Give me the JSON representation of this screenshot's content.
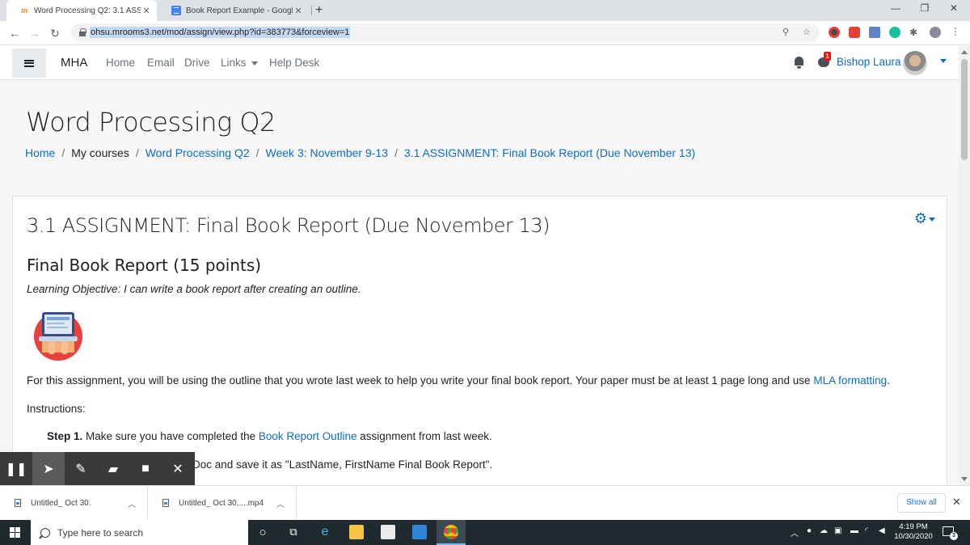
{
  "browser": {
    "tabs": [
      {
        "title": "Word Processing Q2: 3.1 ASSIGN",
        "active": true
      },
      {
        "title": "Book Report Example - Google D",
        "active": false
      }
    ],
    "url": "ohsu.mrooms3.net/mod/assign/view.php?id=383773&forceview=1"
  },
  "nav": {
    "brand": "MHA",
    "links": [
      "Home",
      "Email",
      "Drive",
      "Links",
      "Help Desk"
    ],
    "message_badge": "1",
    "user_name": "Bishop Laura"
  },
  "page": {
    "title": "Word Processing Q2",
    "breadcrumb": [
      "Home",
      "My courses",
      "Word Processing Q2",
      "Week 3: November 9-13",
      "3.1 ASSIGNMENT: Final Book Report (Due November 13)"
    ],
    "breadcrumb_sep": "/"
  },
  "assignment": {
    "title": "3.1 ASSIGNMENT: Final Book Report (Due November 13)",
    "heading": "Final Book Report (15 points)",
    "objective": "Learning Objective: I can write a book report after creating an outline.",
    "intro_text": "For this assignment, you will be using the outline that you wrote last week to help you write your final book report. Your paper must be at least 1 page long and use ",
    "intro_link": "MLA formatting",
    "intro_end": ".",
    "instructions_label": "Instructions:",
    "step1_label": "Step 1.",
    "step1_pre": " Make sure you have completed the ",
    "step1_link": "Book Report Outline",
    "step1_post": " assignment from last week.",
    "step2_partial": "Doc and save it as \"LastName, FirstName Final Book Report\"."
  },
  "downloads": {
    "items": [
      "Untitled_ Oct 30.",
      "Untitled_ Oct 30,....mp4"
    ],
    "show_all": "Show all"
  },
  "taskbar": {
    "search_placeholder": "Type here to search",
    "time": "4:19 PM",
    "date": "10/30/2020",
    "notification_count": "3"
  },
  "colors": {
    "link": "#0f6cbf",
    "page_bg": "#f7f7f7",
    "taskbar": "#1f2a2f"
  }
}
